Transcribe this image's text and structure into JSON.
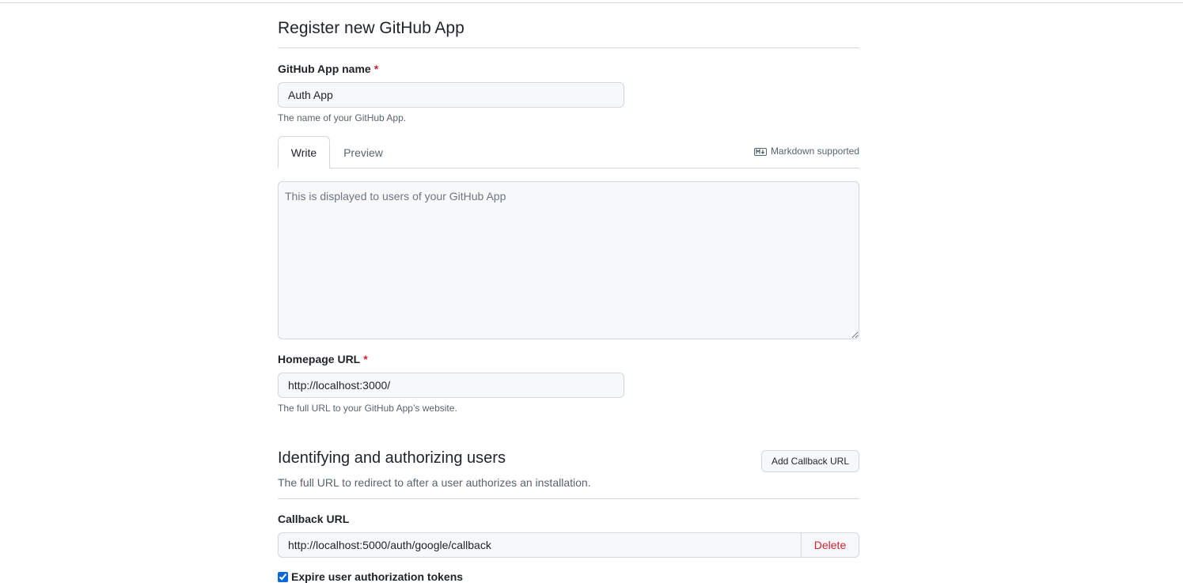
{
  "page": {
    "title": "Register new GitHub App"
  },
  "app_name": {
    "label": "GitHub App name",
    "required_mark": "*",
    "value": "Auth App",
    "note": "The name of your GitHub App."
  },
  "description": {
    "tabs": [
      {
        "label": "Write",
        "active": true
      },
      {
        "label": "Preview",
        "active": false
      }
    ],
    "markdown_hint": "Markdown supported",
    "markdown_icon": "markdown-icon",
    "placeholder": "This is displayed to users of your GitHub App",
    "value": ""
  },
  "homepage": {
    "label": "Homepage URL",
    "required_mark": "*",
    "value": "http://localhost:3000/",
    "note": "The full URL to your GitHub App’s website."
  },
  "identifying": {
    "title": "Identifying and authorizing users",
    "description": "The full URL to redirect to after a user authorizes an installation.",
    "add_callback_label": "Add Callback URL"
  },
  "callback": {
    "label": "Callback URL",
    "value": "http://localhost:5000/auth/google/callback",
    "delete_label": "Delete"
  },
  "expire_tokens": {
    "label": "Expire user authorization tokens",
    "checked": true
  },
  "colors": {
    "required": "#cf222e",
    "border": "#d0d7de",
    "input_bg": "#f6f8fa",
    "muted_text": "#59636e",
    "danger": "#cf222e",
    "accent": "#0969da"
  }
}
